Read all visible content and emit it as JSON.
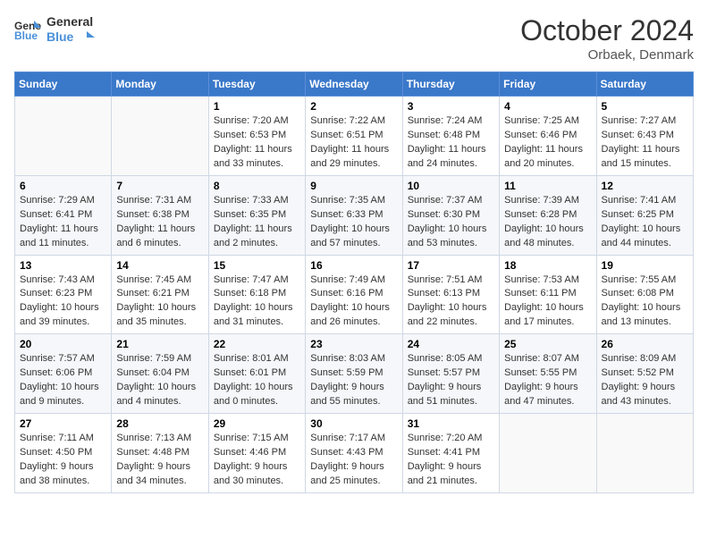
{
  "logo": {
    "line1": "General",
    "line2": "Blue"
  },
  "header": {
    "month": "October 2024",
    "location": "Orbaek, Denmark"
  },
  "weekdays": [
    "Sunday",
    "Monday",
    "Tuesday",
    "Wednesday",
    "Thursday",
    "Friday",
    "Saturday"
  ],
  "weeks": [
    [
      {
        "day": "",
        "sunrise": "",
        "sunset": "",
        "daylight": ""
      },
      {
        "day": "",
        "sunrise": "",
        "sunset": "",
        "daylight": ""
      },
      {
        "day": "1",
        "sunrise": "Sunrise: 7:20 AM",
        "sunset": "Sunset: 6:53 PM",
        "daylight": "Daylight: 11 hours and 33 minutes."
      },
      {
        "day": "2",
        "sunrise": "Sunrise: 7:22 AM",
        "sunset": "Sunset: 6:51 PM",
        "daylight": "Daylight: 11 hours and 29 minutes."
      },
      {
        "day": "3",
        "sunrise": "Sunrise: 7:24 AM",
        "sunset": "Sunset: 6:48 PM",
        "daylight": "Daylight: 11 hours and 24 minutes."
      },
      {
        "day": "4",
        "sunrise": "Sunrise: 7:25 AM",
        "sunset": "Sunset: 6:46 PM",
        "daylight": "Daylight: 11 hours and 20 minutes."
      },
      {
        "day": "5",
        "sunrise": "Sunrise: 7:27 AM",
        "sunset": "Sunset: 6:43 PM",
        "daylight": "Daylight: 11 hours and 15 minutes."
      }
    ],
    [
      {
        "day": "6",
        "sunrise": "Sunrise: 7:29 AM",
        "sunset": "Sunset: 6:41 PM",
        "daylight": "Daylight: 11 hours and 11 minutes."
      },
      {
        "day": "7",
        "sunrise": "Sunrise: 7:31 AM",
        "sunset": "Sunset: 6:38 PM",
        "daylight": "Daylight: 11 hours and 6 minutes."
      },
      {
        "day": "8",
        "sunrise": "Sunrise: 7:33 AM",
        "sunset": "Sunset: 6:35 PM",
        "daylight": "Daylight: 11 hours and 2 minutes."
      },
      {
        "day": "9",
        "sunrise": "Sunrise: 7:35 AM",
        "sunset": "Sunset: 6:33 PM",
        "daylight": "Daylight: 10 hours and 57 minutes."
      },
      {
        "day": "10",
        "sunrise": "Sunrise: 7:37 AM",
        "sunset": "Sunset: 6:30 PM",
        "daylight": "Daylight: 10 hours and 53 minutes."
      },
      {
        "day": "11",
        "sunrise": "Sunrise: 7:39 AM",
        "sunset": "Sunset: 6:28 PM",
        "daylight": "Daylight: 10 hours and 48 minutes."
      },
      {
        "day": "12",
        "sunrise": "Sunrise: 7:41 AM",
        "sunset": "Sunset: 6:25 PM",
        "daylight": "Daylight: 10 hours and 44 minutes."
      }
    ],
    [
      {
        "day": "13",
        "sunrise": "Sunrise: 7:43 AM",
        "sunset": "Sunset: 6:23 PM",
        "daylight": "Daylight: 10 hours and 39 minutes."
      },
      {
        "day": "14",
        "sunrise": "Sunrise: 7:45 AM",
        "sunset": "Sunset: 6:21 PM",
        "daylight": "Daylight: 10 hours and 35 minutes."
      },
      {
        "day": "15",
        "sunrise": "Sunrise: 7:47 AM",
        "sunset": "Sunset: 6:18 PM",
        "daylight": "Daylight: 10 hours and 31 minutes."
      },
      {
        "day": "16",
        "sunrise": "Sunrise: 7:49 AM",
        "sunset": "Sunset: 6:16 PM",
        "daylight": "Daylight: 10 hours and 26 minutes."
      },
      {
        "day": "17",
        "sunrise": "Sunrise: 7:51 AM",
        "sunset": "Sunset: 6:13 PM",
        "daylight": "Daylight: 10 hours and 22 minutes."
      },
      {
        "day": "18",
        "sunrise": "Sunrise: 7:53 AM",
        "sunset": "Sunset: 6:11 PM",
        "daylight": "Daylight: 10 hours and 17 minutes."
      },
      {
        "day": "19",
        "sunrise": "Sunrise: 7:55 AM",
        "sunset": "Sunset: 6:08 PM",
        "daylight": "Daylight: 10 hours and 13 minutes."
      }
    ],
    [
      {
        "day": "20",
        "sunrise": "Sunrise: 7:57 AM",
        "sunset": "Sunset: 6:06 PM",
        "daylight": "Daylight: 10 hours and 9 minutes."
      },
      {
        "day": "21",
        "sunrise": "Sunrise: 7:59 AM",
        "sunset": "Sunset: 6:04 PM",
        "daylight": "Daylight: 10 hours and 4 minutes."
      },
      {
        "day": "22",
        "sunrise": "Sunrise: 8:01 AM",
        "sunset": "Sunset: 6:01 PM",
        "daylight": "Daylight: 10 hours and 0 minutes."
      },
      {
        "day": "23",
        "sunrise": "Sunrise: 8:03 AM",
        "sunset": "Sunset: 5:59 PM",
        "daylight": "Daylight: 9 hours and 55 minutes."
      },
      {
        "day": "24",
        "sunrise": "Sunrise: 8:05 AM",
        "sunset": "Sunset: 5:57 PM",
        "daylight": "Daylight: 9 hours and 51 minutes."
      },
      {
        "day": "25",
        "sunrise": "Sunrise: 8:07 AM",
        "sunset": "Sunset: 5:55 PM",
        "daylight": "Daylight: 9 hours and 47 minutes."
      },
      {
        "day": "26",
        "sunrise": "Sunrise: 8:09 AM",
        "sunset": "Sunset: 5:52 PM",
        "daylight": "Daylight: 9 hours and 43 minutes."
      }
    ],
    [
      {
        "day": "27",
        "sunrise": "Sunrise: 7:11 AM",
        "sunset": "Sunset: 4:50 PM",
        "daylight": "Daylight: 9 hours and 38 minutes."
      },
      {
        "day": "28",
        "sunrise": "Sunrise: 7:13 AM",
        "sunset": "Sunset: 4:48 PM",
        "daylight": "Daylight: 9 hours and 34 minutes."
      },
      {
        "day": "29",
        "sunrise": "Sunrise: 7:15 AM",
        "sunset": "Sunset: 4:46 PM",
        "daylight": "Daylight: 9 hours and 30 minutes."
      },
      {
        "day": "30",
        "sunrise": "Sunrise: 7:17 AM",
        "sunset": "Sunset: 4:43 PM",
        "daylight": "Daylight: 9 hours and 25 minutes."
      },
      {
        "day": "31",
        "sunrise": "Sunrise: 7:20 AM",
        "sunset": "Sunset: 4:41 PM",
        "daylight": "Daylight: 9 hours and 21 minutes."
      },
      {
        "day": "",
        "sunrise": "",
        "sunset": "",
        "daylight": ""
      },
      {
        "day": "",
        "sunrise": "",
        "sunset": "",
        "daylight": ""
      }
    ]
  ]
}
